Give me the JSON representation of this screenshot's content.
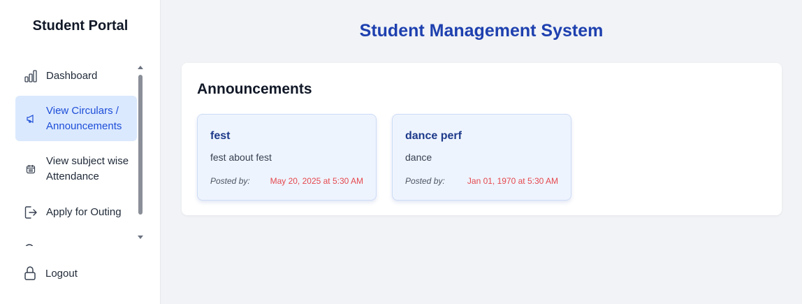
{
  "sidebar": {
    "brand": "Student Portal",
    "items": [
      {
        "label": "Dashboard",
        "icon": "bar-chart-icon",
        "active": false
      },
      {
        "label": "View Circulars /\nAnnouncements",
        "icon": "megaphone-icon",
        "active": true
      },
      {
        "label": "View subject wise\nAttendance",
        "icon": "calendar-icon",
        "active": false
      },
      {
        "label": "Apply for Outing",
        "icon": "exit-icon",
        "active": false
      }
    ],
    "logout": {
      "label": "Logout",
      "icon": "lock-icon"
    }
  },
  "header": {
    "title": "Student Management System"
  },
  "announcements": {
    "heading": "Announcements",
    "cards": [
      {
        "title": "fest",
        "description": "fest about fest",
        "posted_label": "Posted by:",
        "date": "May 20, 2025 at 5:30 AM"
      },
      {
        "title": "dance perf",
        "description": "dance",
        "posted_label": "Posted by:",
        "date": "Jan 01, 1970 at 5:30 AM"
      }
    ]
  },
  "colors": {
    "accent": "#1e40af",
    "active_bg": "#dbe9fe",
    "date_red": "#e5484d",
    "card_bg": "#eef4fe"
  }
}
